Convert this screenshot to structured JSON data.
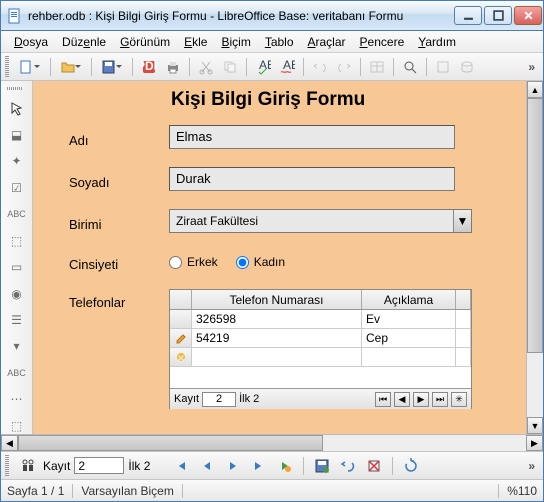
{
  "window": {
    "title": "rehber.odb : Kişi Bilgi Giriş Formu - LibreOffice Base: veritabanı Formu"
  },
  "menu": [
    "Dosya",
    "Düzenle",
    "Görünüm",
    "Ekle",
    "Biçim",
    "Tablo",
    "Araçlar",
    "Pencere",
    "Yardım"
  ],
  "form": {
    "title": "Kişi Bilgi Giriş Formu",
    "labels": {
      "adi": "Adı",
      "soyadi": "Soyadı",
      "birimi": "Birimi",
      "cinsiyeti": "Cinsiyeti",
      "telefonlar": "Telefonlar"
    },
    "values": {
      "adi": "Elmas",
      "soyadi": "Durak",
      "birimi": "Ziraat Fakültesi"
    },
    "radios": {
      "erkek": "Erkek",
      "kadin": "Kadın",
      "selected": "kadin"
    },
    "subgrid": {
      "headers": [
        "Telefon Numarası",
        "Açıklama"
      ],
      "rows": [
        {
          "marker": "",
          "num": "326598",
          "acik": "Ev"
        },
        {
          "marker": "edit",
          "num": "54219",
          "acik": "Cep"
        },
        {
          "marker": "new",
          "num": "",
          "acik": ""
        }
      ],
      "nav": {
        "label": "Kayıt",
        "pos": "2",
        "total": "İlk 2"
      }
    }
  },
  "bottomnav": {
    "label": "Kayıt",
    "pos": "2",
    "total": "İlk  2"
  },
  "status": {
    "page": "Sayfa 1 / 1",
    "style": "Varsayılan Biçem",
    "zoom": "%110"
  }
}
